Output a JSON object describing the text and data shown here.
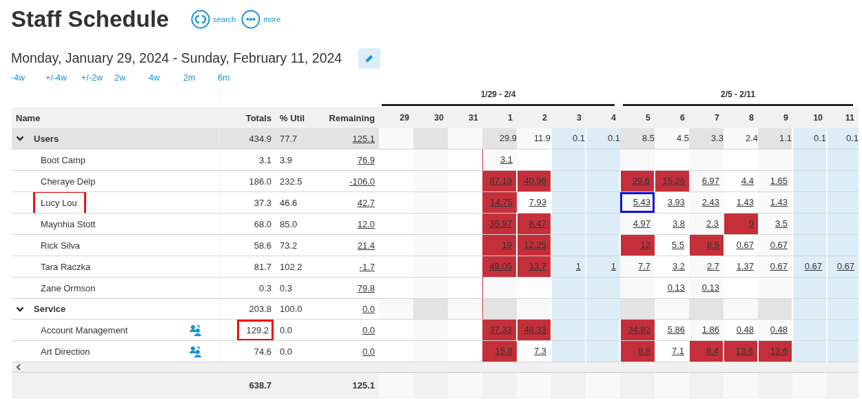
{
  "title": "Staff Schedule",
  "header_actions": [
    {
      "kind": "search",
      "label": "search"
    },
    {
      "kind": "more",
      "label": "more"
    }
  ],
  "date_range": "Monday, January 29, 2024 - Sunday, February 11, 2024",
  "range_links": [
    "-4w",
    "+/-4w",
    "+/-2w",
    "2w",
    "4w",
    "2m",
    "6m"
  ],
  "columns": {
    "name": "Name",
    "totals": "Totals",
    "util": "% Util",
    "remaining": "Remaining"
  },
  "weeks": [
    {
      "label": "1/29 - 2/4",
      "days": [
        {
          "label": "29",
          "kind": "weekday"
        },
        {
          "label": "30",
          "kind": "weekday"
        },
        {
          "label": "31",
          "kind": "weekday"
        },
        {
          "label": "1",
          "kind": "today"
        },
        {
          "label": "2",
          "kind": "weekday"
        },
        {
          "label": "3",
          "kind": "weekend"
        },
        {
          "label": "4",
          "kind": "weekend"
        }
      ]
    },
    {
      "label": "2/5 - 2/11",
      "days": [
        {
          "label": "5",
          "kind": "weekday"
        },
        {
          "label": "6",
          "kind": "weekday"
        },
        {
          "label": "7",
          "kind": "weekday"
        },
        {
          "label": "8",
          "kind": "weekday"
        },
        {
          "label": "9",
          "kind": "weekday"
        },
        {
          "label": "10",
          "kind": "weekend"
        },
        {
          "label": "11",
          "kind": "weekend"
        }
      ]
    }
  ],
  "groups": [
    {
      "name": "Users",
      "expanded": true,
      "totals": "434.9",
      "util": "77.7",
      "remaining": "125.1",
      "days": [
        {
          "kind": "blank"
        },
        {
          "kind": "blank"
        },
        {
          "kind": "blank"
        },
        {
          "kind": "total",
          "text": "29.9"
        },
        {
          "kind": "total",
          "text": "11.9"
        },
        {
          "kind": "total",
          "text": "0.1"
        },
        {
          "kind": "total",
          "text": "0.1"
        },
        {
          "kind": "total",
          "text": "8.5"
        },
        {
          "kind": "total",
          "text": "4.5"
        },
        {
          "kind": "total",
          "text": "3.3"
        },
        {
          "kind": "total",
          "text": "2.4"
        },
        {
          "kind": "total",
          "text": "1.1"
        },
        {
          "kind": "total",
          "text": "0.1"
        },
        {
          "kind": "total",
          "text": "0.1"
        }
      ],
      "children": [
        {
          "name": "Boot Camp",
          "reassign": false,
          "totals": "3.1",
          "util": "3.9",
          "remaining": "76.9",
          "days": [
            {
              "kind": "blank"
            },
            {
              "kind": "blank"
            },
            {
              "kind": "blank"
            },
            {
              "kind": "hours",
              "text": "3.1",
              "over": false
            },
            {
              "kind": "blank"
            },
            {
              "kind": "blank"
            },
            {
              "kind": "blank"
            },
            {
              "kind": "blank"
            },
            {
              "kind": "blank"
            },
            {
              "kind": "blank"
            },
            {
              "kind": "blank"
            },
            {
              "kind": "blank"
            },
            {
              "kind": "blank"
            },
            {
              "kind": "blank"
            }
          ]
        },
        {
          "name": "Cheraye Delp",
          "reassign": false,
          "totals": "186.0",
          "util": "232.5",
          "remaining": "-106.0",
          "days": [
            {
              "kind": "blank"
            },
            {
              "kind": "blank"
            },
            {
              "kind": "blank"
            },
            {
              "kind": "hours",
              "text": "87.13",
              "over": true
            },
            {
              "kind": "hours",
              "text": "40.96",
              "over": true
            },
            {
              "kind": "blank"
            },
            {
              "kind": "blank"
            },
            {
              "kind": "hours",
              "text": "29.6",
              "over": true
            },
            {
              "kind": "hours",
              "text": "15.26",
              "over": true
            },
            {
              "kind": "hours",
              "text": "6.97",
              "over": false
            },
            {
              "kind": "hours",
              "text": "4.4",
              "over": false
            },
            {
              "kind": "hours",
              "text": "1.65",
              "over": false
            },
            {
              "kind": "blank"
            },
            {
              "kind": "blank"
            }
          ]
        },
        {
          "name": "Lucy Lou",
          "name_highlighted": true,
          "reassign": false,
          "totals": "37.3",
          "util": "46.6",
          "remaining": "42.7",
          "days": [
            {
              "kind": "blank"
            },
            {
              "kind": "blank"
            },
            {
              "kind": "blank"
            },
            {
              "kind": "hours",
              "text": "14.75",
              "over": true
            },
            {
              "kind": "hours",
              "text": "7.93",
              "over": false
            },
            {
              "kind": "blank"
            },
            {
              "kind": "blank"
            },
            {
              "kind": "hours",
              "text": "5.43",
              "over": false,
              "focused": true
            },
            {
              "kind": "hours",
              "text": "3.93",
              "over": false
            },
            {
              "kind": "hours",
              "text": "2.43",
              "over": false
            },
            {
              "kind": "hours",
              "text": "1.43",
              "over": false
            },
            {
              "kind": "hours",
              "text": "1.43",
              "over": false
            },
            {
              "kind": "blank"
            },
            {
              "kind": "blank"
            }
          ]
        },
        {
          "name": "Maynhia Stott",
          "reassign": false,
          "totals": "68.0",
          "util": "85.0",
          "remaining": "12.0",
          "days": [
            {
              "kind": "blank"
            },
            {
              "kind": "blank"
            },
            {
              "kind": "blank"
            },
            {
              "kind": "hours",
              "text": "35.97",
              "over": true
            },
            {
              "kind": "hours",
              "text": "8.47",
              "over": true
            },
            {
              "kind": "blank"
            },
            {
              "kind": "blank"
            },
            {
              "kind": "hours",
              "text": "4.97",
              "over": false
            },
            {
              "kind": "hours",
              "text": "3.8",
              "over": false
            },
            {
              "kind": "hours",
              "text": "2.3",
              "over": false
            },
            {
              "kind": "hours",
              "text": "9",
              "over": true
            },
            {
              "kind": "hours",
              "text": "3.5",
              "over": false
            },
            {
              "kind": "blank"
            },
            {
              "kind": "blank"
            }
          ]
        },
        {
          "name": "Rick Silva",
          "reassign": false,
          "totals": "58.6",
          "util": "73.2",
          "remaining": "21.4",
          "days": [
            {
              "kind": "blank"
            },
            {
              "kind": "blank"
            },
            {
              "kind": "blank"
            },
            {
              "kind": "hours",
              "text": "19",
              "over": true
            },
            {
              "kind": "hours",
              "text": "12.25",
              "over": true
            },
            {
              "kind": "blank"
            },
            {
              "kind": "blank"
            },
            {
              "kind": "hours",
              "text": "12",
              "over": true
            },
            {
              "kind": "hours",
              "text": "5.5",
              "over": false
            },
            {
              "kind": "hours",
              "text": "8.5",
              "over": true
            },
            {
              "kind": "hours",
              "text": "0.67",
              "over": false
            },
            {
              "kind": "hours",
              "text": "0.67",
              "over": false
            },
            {
              "kind": "blank"
            },
            {
              "kind": "blank"
            }
          ]
        },
        {
          "name": "Tara Raczka",
          "reassign": false,
          "totals": "81.7",
          "util": "102.2",
          "remaining": "-1.7",
          "days": [
            {
              "kind": "blank"
            },
            {
              "kind": "blank"
            },
            {
              "kind": "blank"
            },
            {
              "kind": "hours",
              "text": "49.05",
              "over": true
            },
            {
              "kind": "hours",
              "text": "13.7",
              "over": true
            },
            {
              "kind": "hours",
              "text": "1",
              "over": false
            },
            {
              "kind": "hours",
              "text": "1",
              "over": false
            },
            {
              "kind": "hours",
              "text": "7.7",
              "over": false
            },
            {
              "kind": "hours",
              "text": "3.2",
              "over": false
            },
            {
              "kind": "hours",
              "text": "2.7",
              "over": false
            },
            {
              "kind": "hours",
              "text": "1.37",
              "over": false
            },
            {
              "kind": "hours",
              "text": "0.67",
              "over": false
            },
            {
              "kind": "hours",
              "text": "0.67",
              "over": false
            },
            {
              "kind": "hours",
              "text": "0.67",
              "over": false
            }
          ]
        },
        {
          "name": "Zane Ormson",
          "reassign": false,
          "totals": "0.3",
          "util": "0.3",
          "remaining": "79.8",
          "days": [
            {
              "kind": "blank"
            },
            {
              "kind": "blank"
            },
            {
              "kind": "blank"
            },
            {
              "kind": "blank"
            },
            {
              "kind": "blank"
            },
            {
              "kind": "blank"
            },
            {
              "kind": "blank"
            },
            {
              "kind": "blank"
            },
            {
              "kind": "hours",
              "text": "0.13",
              "over": false
            },
            {
              "kind": "hours",
              "text": "0.13",
              "over": false
            },
            {
              "kind": "blank"
            },
            {
              "kind": "blank"
            },
            {
              "kind": "blank"
            },
            {
              "kind": "blank"
            }
          ]
        }
      ]
    },
    {
      "name": "Service",
      "expanded": true,
      "totals": "203.8",
      "util": "100.0",
      "remaining": "0.0",
      "children": [
        {
          "name": "Account Management",
          "reassign": true,
          "totals": "129.2",
          "totals_highlighted": true,
          "util": "0.0",
          "remaining": "0.0",
          "days": [
            {
              "kind": "blank"
            },
            {
              "kind": "blank"
            },
            {
              "kind": "blank"
            },
            {
              "kind": "hours",
              "text": "37.33",
              "over": true
            },
            {
              "kind": "hours",
              "text": "48.33",
              "over": true
            },
            {
              "kind": "blank"
            },
            {
              "kind": "blank"
            },
            {
              "kind": "hours",
              "text": "34.82",
              "over": true
            },
            {
              "kind": "hours",
              "text": "5.86",
              "over": false
            },
            {
              "kind": "hours",
              "text": "1.86",
              "over": false
            },
            {
              "kind": "hours",
              "text": "0.48",
              "over": false
            },
            {
              "kind": "hours",
              "text": "0.48",
              "over": false
            },
            {
              "kind": "blank"
            },
            {
              "kind": "blank"
            }
          ]
        },
        {
          "name": "Art Direction",
          "reassign": true,
          "totals": "74.6",
          "util": "0.0",
          "remaining": "0.0",
          "days": [
            {
              "kind": "blank"
            },
            {
              "kind": "blank"
            },
            {
              "kind": "blank"
            },
            {
              "kind": "hours",
              "text": "15.8",
              "over": true
            },
            {
              "kind": "hours",
              "text": "7.3",
              "over": false
            },
            {
              "kind": "blank"
            },
            {
              "kind": "blank"
            },
            {
              "kind": "hours",
              "text": "8.8",
              "over": true
            },
            {
              "kind": "hours",
              "text": "7.1",
              "over": false
            },
            {
              "kind": "hours",
              "text": "8.4",
              "over": true
            },
            {
              "kind": "hours",
              "text": "13.6",
              "over": true
            },
            {
              "kind": "hours",
              "text": "13.6",
              "over": true
            },
            {
              "kind": "blank"
            },
            {
              "kind": "blank"
            }
          ]
        }
      ]
    }
  ],
  "footer": {
    "totals": "638.7",
    "remaining": "125.1"
  }
}
